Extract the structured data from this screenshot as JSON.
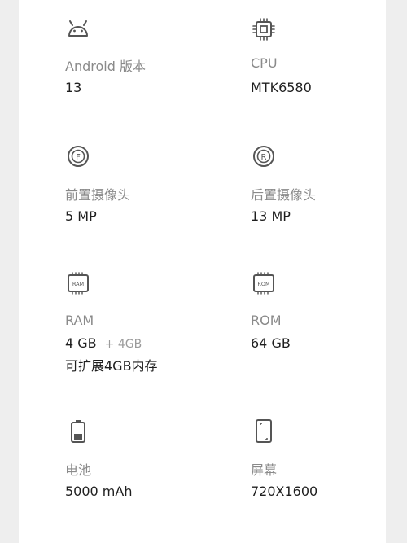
{
  "specs": [
    {
      "icon": "android-icon",
      "label": "Android 版本",
      "value": "13"
    },
    {
      "icon": "cpu-chip-icon",
      "label": "CPU",
      "value": "MTK6580"
    },
    {
      "icon": "front-camera-icon",
      "icon_letter": "F",
      "label": "前置摄像头",
      "value": "5 MP"
    },
    {
      "icon": "rear-camera-icon",
      "icon_letter": "R",
      "label": "后置摄像头",
      "value": "13 MP"
    },
    {
      "icon": "ram-chip-icon",
      "icon_text": "RAM",
      "label": "RAM",
      "value": "4 GB",
      "extra": "+ 4GB",
      "note": "可扩展4GB内存"
    },
    {
      "icon": "rom-chip-icon",
      "icon_text": "ROM",
      "label": "ROM",
      "value": "64 GB"
    },
    {
      "icon": "battery-icon",
      "label": "电池",
      "value": "5000 mAh"
    },
    {
      "icon": "screen-icon",
      "label": "屏幕",
      "value": "720X1600"
    }
  ],
  "colors": {
    "background": "#eeeeee",
    "card": "#ffffff",
    "label": "#8a8a8a",
    "value": "#1f1f1f",
    "icon": "#555555"
  }
}
